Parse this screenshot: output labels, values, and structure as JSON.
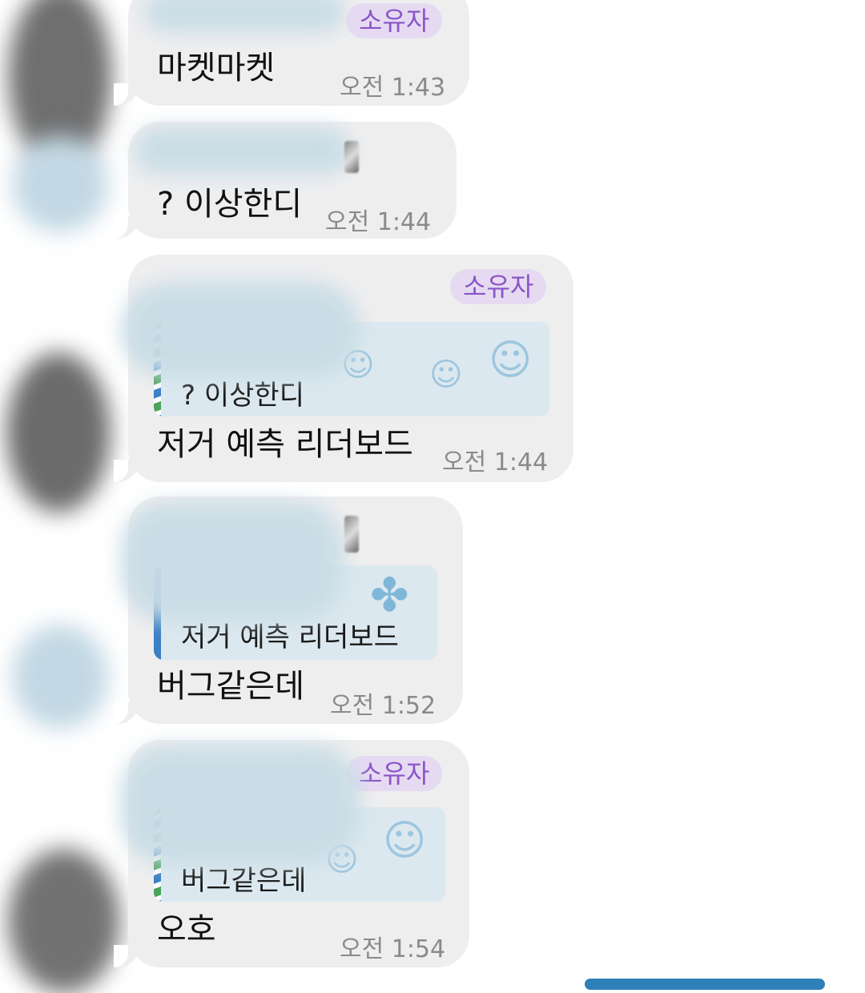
{
  "messages": [
    {
      "badge": "소유자",
      "text": "마켓마켓",
      "time": "오전 1:43"
    },
    {
      "badge": "",
      "text": "? 이상한디",
      "time": "오전 1:44"
    },
    {
      "badge": "소유자",
      "reply_text": "? 이상한디",
      "text": "저거 예측 리더보드",
      "time": "오전 1:44"
    },
    {
      "badge": "",
      "reply_text": "저거 예측 리더보드",
      "text": "버그같은데",
      "time": "오전 1:52"
    },
    {
      "badge": "소유자",
      "reply_text": "버그같은데",
      "text": "오호",
      "time": "오전 1:54"
    }
  ],
  "icons": {
    "reply_stamp_1": "halo-face-icon",
    "reply_stamp_2": "voodoo-doll-icon",
    "reply_stamp_3": "halo-face-icon"
  },
  "colors": {
    "bubble": "#eeeeef",
    "badge_bg": "#e6daf2",
    "badge_text": "#8a55c8",
    "reply_bar": "#3b7fc4",
    "time": "#8a8a8a"
  }
}
